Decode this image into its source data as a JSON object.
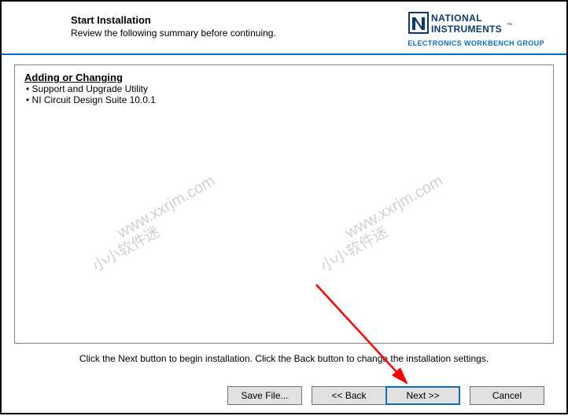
{
  "header": {
    "title": "Start Installation",
    "subtitle": "Review the following summary before continuing.",
    "brand_top": "NATIONAL",
    "brand_bottom": "INSTRUMENTS",
    "brand_tagline": "ELECTRONICS WORKBENCH GROUP"
  },
  "summary": {
    "section_title": "Adding or Changing",
    "items": [
      "Support and Upgrade Utility",
      "NI Circuit Design Suite 10.0.1"
    ]
  },
  "instruction": "Click the Next button to begin installation.  Click the Back button to change the installation settings.",
  "buttons": {
    "save_file": "Save File...",
    "back": "<< Back",
    "next": "Next >>",
    "cancel": "Cancel"
  },
  "watermarks": {
    "url": "www.xxrjm.com",
    "cn": "小小软件迷"
  }
}
